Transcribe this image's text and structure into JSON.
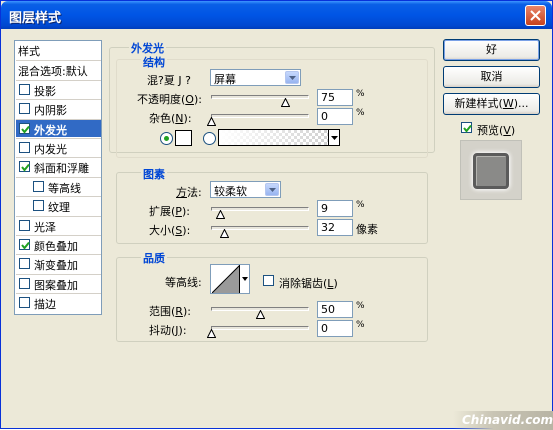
{
  "window": {
    "title": "图层样式"
  },
  "styles_panel": {
    "items": [
      {
        "label": "样式",
        "has_checkbox": false,
        "checked": false,
        "selected": false,
        "indent": false
      },
      {
        "label": "混合选项:默认",
        "has_checkbox": false,
        "checked": false,
        "selected": false,
        "indent": false
      },
      {
        "label": "投影",
        "has_checkbox": true,
        "checked": false,
        "selected": false,
        "indent": false
      },
      {
        "label": "内阴影",
        "has_checkbox": true,
        "checked": false,
        "selected": false,
        "indent": false
      },
      {
        "label": "外发光",
        "has_checkbox": true,
        "checked": true,
        "selected": true,
        "indent": false
      },
      {
        "label": "内发光",
        "has_checkbox": true,
        "checked": false,
        "selected": false,
        "indent": false
      },
      {
        "label": "斜面和浮雕",
        "has_checkbox": true,
        "checked": true,
        "selected": false,
        "indent": false
      },
      {
        "label": "等高线",
        "has_checkbox": true,
        "checked": false,
        "selected": false,
        "indent": true
      },
      {
        "label": "纹理",
        "has_checkbox": true,
        "checked": false,
        "selected": false,
        "indent": true
      },
      {
        "label": "光泽",
        "has_checkbox": true,
        "checked": false,
        "selected": false,
        "indent": false
      },
      {
        "label": "颜色叠加",
        "has_checkbox": true,
        "checked": true,
        "selected": false,
        "indent": false
      },
      {
        "label": "渐变叠加",
        "has_checkbox": true,
        "checked": false,
        "selected": false,
        "indent": false
      },
      {
        "label": "图案叠加",
        "has_checkbox": true,
        "checked": false,
        "selected": false,
        "indent": false
      },
      {
        "label": "描边",
        "has_checkbox": true,
        "checked": false,
        "selected": false,
        "indent": false
      }
    ]
  },
  "outer_glow": {
    "title": "外发光",
    "structure": {
      "title": "结构",
      "blend_mode_label": "混?夏 J ?",
      "blend_mode_value": "屏幕",
      "opacity_label": "不透明度(O):",
      "opacity_value": "75",
      "opacity_fraction": 0.75,
      "opacity_unit": "%",
      "noise_label": "杂色(N):",
      "noise_value": "0",
      "noise_fraction": 0,
      "noise_unit": "%"
    },
    "elements": {
      "title": "图素",
      "technique_label": "方法:",
      "technique_value": "较柔软",
      "spread_label": "扩展(P):",
      "spread_value": "9",
      "spread_fraction": 0.09,
      "spread_unit": "%",
      "size_label": "大小(S):",
      "size_value": "32",
      "size_fraction": 0.128,
      "size_unit": "像素"
    },
    "quality": {
      "title": "品质",
      "contour_label": "等高线:",
      "antialias_label": "消除锯齿(L)",
      "antialias_checked": false,
      "range_label": "范围(R):",
      "range_value": "50",
      "range_fraction": 0.5,
      "range_unit": "%",
      "jitter_label": "抖动(J):",
      "jitter_value": "0",
      "jitter_fraction": 0,
      "jitter_unit": "%"
    }
  },
  "buttons": {
    "ok": "好",
    "cancel": "取消",
    "new_style": "新建样式(W)...",
    "preview_label": "预览(V)",
    "preview_checked": true
  },
  "watermark": "Chinavid.com",
  "colors": {
    "title_bar": "#0055e5",
    "selection": "#316ac5",
    "group_title": "#0046d5",
    "dialog_bg": "#ece9d8"
  }
}
